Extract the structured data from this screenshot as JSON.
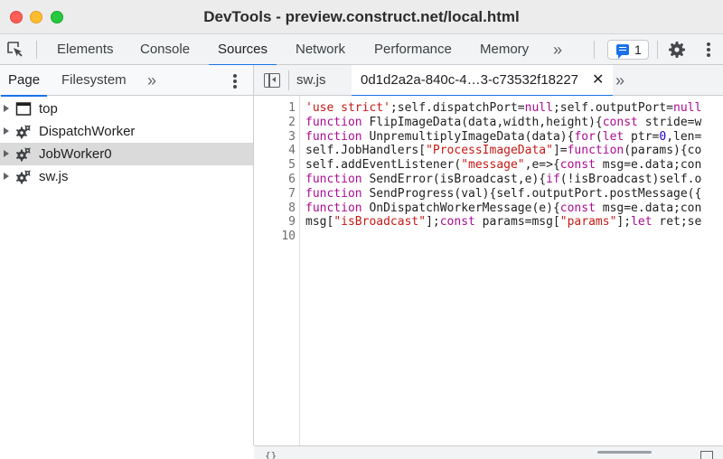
{
  "window": {
    "title": "DevTools - preview.construct.net/local.html"
  },
  "toolbar": {
    "tabs": [
      {
        "label": "Elements"
      },
      {
        "label": "Console"
      },
      {
        "label": "Sources"
      },
      {
        "label": "Network"
      },
      {
        "label": "Performance"
      },
      {
        "label": "Memory"
      }
    ],
    "active_tab": "Sources",
    "more_label": "»",
    "issues_count": "1"
  },
  "navigator": {
    "tabs": [
      {
        "label": "Page"
      },
      {
        "label": "Filesystem"
      }
    ],
    "active_tab": "Page",
    "more_label": "»",
    "tree": [
      {
        "label": "top",
        "icon": "frame-icon",
        "selected": false
      },
      {
        "label": "DispatchWorker",
        "icon": "gear-icon",
        "selected": false
      },
      {
        "label": "JobWorker0",
        "icon": "gear-icon",
        "selected": true
      },
      {
        "label": "sw.js",
        "icon": "gear-icon",
        "selected": false
      }
    ]
  },
  "editor": {
    "tabs": [
      {
        "label": "sw.js",
        "active": false
      },
      {
        "label": "0d1d2a2a-840c-4…3-c73532f18227",
        "active": true
      }
    ],
    "close_label": "✕",
    "more_label": "»",
    "line_numbers": [
      "1",
      "2",
      "3",
      "4",
      "5",
      "6",
      "7",
      "8",
      "9",
      "10"
    ],
    "code_lines": [
      "'use strict';self.dispatchPort=null;self.outputPort=null",
      "function FlipImageData(data,width,height){const stride=w",
      "function UnpremultiplyImageData(data){for(let ptr=0,len=",
      "self.JobHandlers[\"ProcessImageData\"]=function(params){co",
      "self.addEventListener(\"message\",e=>{const msg=e.data;con",
      "function SendError(isBroadcast,e){if(!isBroadcast)self.o",
      "function SendProgress(val){self.outputPort.postMessage({",
      "function OnDispatchWorkerMessage(e){const msg=e.data;con",
      "msg[\"isBroadcast\"];const params=msg[\"params\"];let ret;se",
      ""
    ]
  },
  "statusbar": {
    "pretty_print_label": "{}"
  }
}
